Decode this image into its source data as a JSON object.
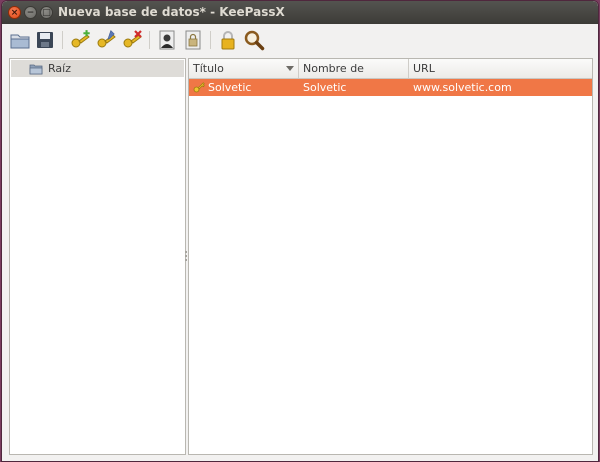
{
  "window": {
    "title": "Nueva base de datos* - KeePassX",
    "close_glyph": "×",
    "minimize_glyph": "−",
    "maximize_glyph": "□"
  },
  "toolbar": {
    "items": [
      {
        "icon": "new-database-icon"
      },
      {
        "icon": "save-database-icon"
      },
      {
        "icon": "add-entry-icon"
      },
      {
        "icon": "edit-entry-icon"
      },
      {
        "icon": "delete-entry-icon"
      },
      {
        "icon": "copy-username-icon"
      },
      {
        "icon": "copy-password-icon"
      },
      {
        "icon": "lock-database-icon"
      },
      {
        "icon": "search-icon"
      }
    ]
  },
  "tree": {
    "root_label": "Raíz"
  },
  "table": {
    "columns": [
      "Título",
      "Nombre de usuario:",
      "URL"
    ],
    "rows": [
      {
        "title": "Solvetic",
        "username": "Solvetic",
        "url": "www.solvetic.com"
      }
    ]
  },
  "colors": {
    "selection": "#f07746",
    "titlebar": "#3c3b37",
    "accent_close": "#df4a16"
  }
}
